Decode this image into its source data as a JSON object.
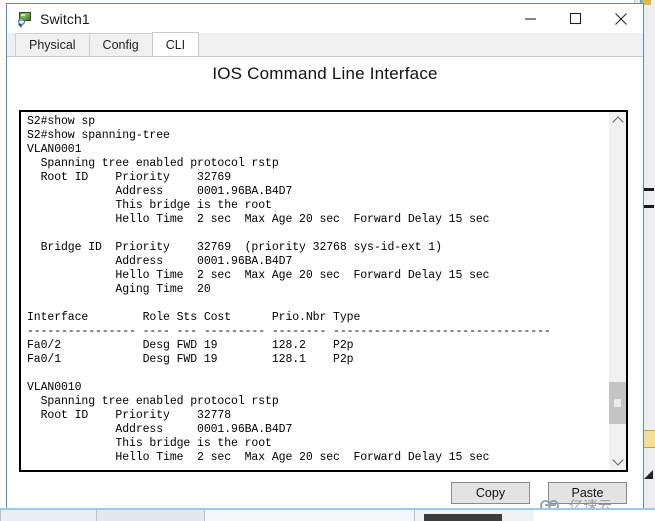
{
  "window": {
    "title": "Switch1",
    "icon": "switch-device-icon",
    "controls": {
      "minimize": "minimize-icon",
      "maximize": "maximize-icon",
      "close": "close-icon"
    }
  },
  "tabs": [
    {
      "label": "Physical",
      "active": false
    },
    {
      "label": "Config",
      "active": false
    },
    {
      "label": "CLI",
      "active": true
    }
  ],
  "panel": {
    "title": "IOS Command Line Interface"
  },
  "terminal": {
    "lines": [
      "S2#show sp",
      "S2#show spanning-tree",
      "VLAN0001",
      "  Spanning tree enabled protocol rstp",
      "  Root ID    Priority    32769",
      "             Address     0001.96BA.B4D7",
      "             This bridge is the root",
      "             Hello Time  2 sec  Max Age 20 sec  Forward Delay 15 sec",
      "",
      "  Bridge ID  Priority    32769  (priority 32768 sys-id-ext 1)",
      "             Address     0001.96BA.B4D7",
      "             Hello Time  2 sec  Max Age 20 sec  Forward Delay 15 sec",
      "             Aging Time  20",
      "",
      "Interface        Role Sts Cost      Prio.Nbr Type",
      "---------------- ---- --- --------- -------- --------------------------------",
      "Fa0/2            Desg FWD 19        128.2    P2p",
      "Fa0/1            Desg FWD 19        128.1    P2p",
      "",
      "VLAN0010",
      "  Spanning tree enabled protocol rstp",
      "  Root ID    Priority    32778",
      "             Address     0001.96BA.B4D7",
      "             This bridge is the root",
      "             Hello Time  2 sec  Max Age 20 sec  Forward Delay 15 sec"
    ],
    "scrollbar": {
      "up_arrow": "chevron-up-icon",
      "down_arrow": "chevron-down-icon",
      "thumb_top_pct": 78,
      "thumb_height_pct": 13
    }
  },
  "actions": {
    "copy_label": "Copy",
    "paste_label": "Paste"
  },
  "watermark": {
    "text": "亿速云",
    "logo": "cloud-rings-logo"
  },
  "colors": {
    "window_border": "#4a90c4",
    "tab_active_bg": "#ffffff",
    "tab_inactive_bg": "#f0f0f0",
    "terminal_bg": "#ffffff",
    "terminal_fg": "#000000",
    "button_bg": "#e3e3e3",
    "watermark_fg": "#8d9aa6"
  }
}
